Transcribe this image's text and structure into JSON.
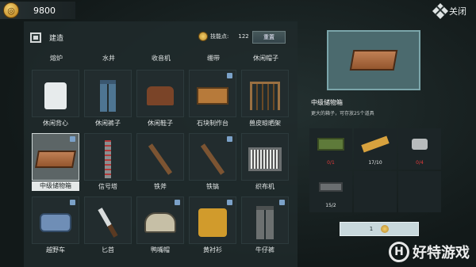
{
  "currency": {
    "value": "9800"
  },
  "close": {
    "label": "关闭"
  },
  "header": {
    "title": "建造",
    "skill_label": "技能点:",
    "skill_value": "122",
    "reset_label": "重置"
  },
  "top_row_labels": [
    "熔炉",
    "水井",
    "收音机",
    "绷带",
    "休闲帽子"
  ],
  "grid_rows": [
    [
      {
        "label": "休闲背心",
        "icon": "shirt-icon",
        "badge": false
      },
      {
        "label": "休闲裤子",
        "icon": "pants-icon",
        "badge": false
      },
      {
        "label": "休闲鞋子",
        "icon": "boots-icon",
        "badge": false
      },
      {
        "label": "石块制作台",
        "icon": "workbench-icon",
        "badge": true
      },
      {
        "label": "兽皮晾晒架",
        "icon": "drying-rack-icon",
        "badge": false
      }
    ],
    [
      {
        "label": "中级储物箱",
        "icon": "crate-icon",
        "badge": true,
        "selected": true
      },
      {
        "label": "信号塔",
        "icon": "tower-icon",
        "badge": false
      },
      {
        "label": "铁斧",
        "icon": "axe-icon",
        "badge": false
      },
      {
        "label": "铁镐",
        "icon": "pickaxe-icon",
        "badge": true
      },
      {
        "label": "织布机",
        "icon": "loom-icon",
        "badge": false
      }
    ],
    [
      {
        "label": "越野车",
        "icon": "car-icon",
        "badge": true
      },
      {
        "label": "匕首",
        "icon": "knife-icon",
        "badge": false
      },
      {
        "label": "鸭嘴帽",
        "icon": "cap-icon",
        "badge": true
      },
      {
        "label": "黄衬衫",
        "icon": "tshirt-icon",
        "badge": true
      },
      {
        "label": "牛仔裤",
        "icon": "jeans-icon",
        "badge": true
      }
    ]
  ],
  "detail": {
    "name": "中级储物箱",
    "description": "更大的箱子，可存放25个道具",
    "materials": [
      {
        "icon": "ammo-box-icon",
        "qty": "0/1",
        "enough": false
      },
      {
        "icon": "plank-icon",
        "qty": "17/10",
        "enough": true
      },
      {
        "icon": "bolt-icon",
        "qty": "0/4",
        "enough": false
      },
      {
        "icon": "ingot-icon",
        "qty": "15/2",
        "enough": true
      }
    ],
    "confirm_count": "1"
  },
  "watermark": {
    "text": "好特游戏",
    "logo": "H"
  }
}
